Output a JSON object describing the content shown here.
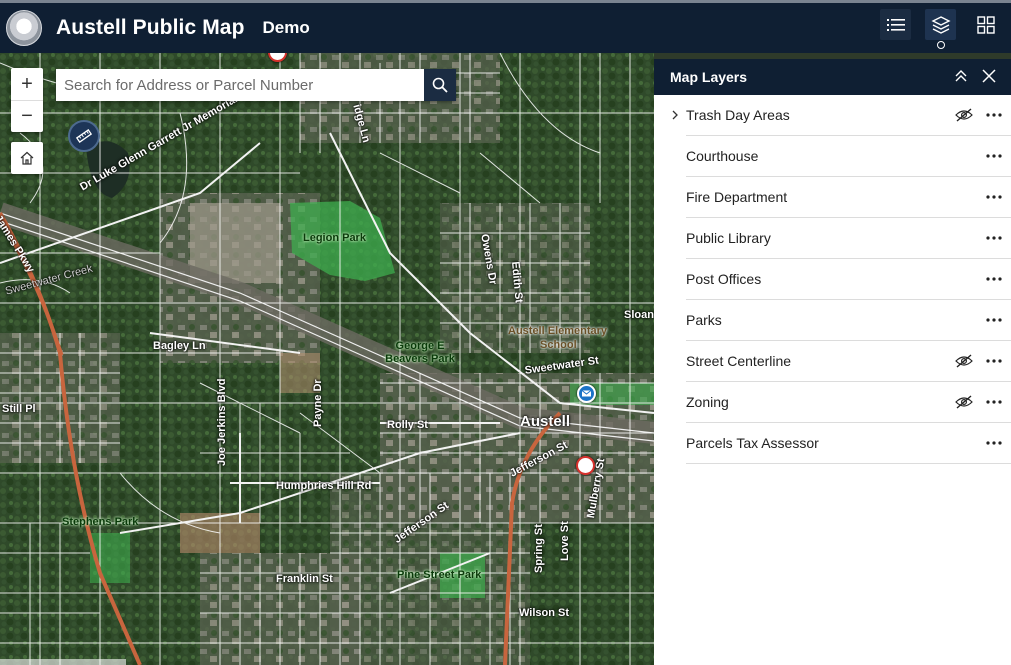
{
  "header": {
    "title": "Austell Public Map",
    "subtitle": "Demo"
  },
  "search": {
    "placeholder": "Search for Address or Parcel Number"
  },
  "zoom": {
    "in_label": "+",
    "out_label": "−"
  },
  "panel": {
    "title": "Map Layers",
    "layers": [
      {
        "label": "Trash Day Areas",
        "expandable": true,
        "hidden": true
      },
      {
        "label": "Courthouse",
        "expandable": false,
        "hidden": false
      },
      {
        "label": "Fire Department",
        "expandable": false,
        "hidden": false
      },
      {
        "label": "Public Library",
        "expandable": false,
        "hidden": false
      },
      {
        "label": "Post Offices",
        "expandable": false,
        "hidden": false
      },
      {
        "label": "Parks",
        "expandable": false,
        "hidden": false
      },
      {
        "label": "Street Centerline",
        "expandable": false,
        "hidden": true
      },
      {
        "label": "Zoning",
        "expandable": false,
        "hidden": true
      },
      {
        "label": "Parcels Tax Assessor",
        "expandable": false,
        "hidden": false
      }
    ]
  },
  "map": {
    "labels": {
      "legion_park": "Legion Park",
      "dr_luke": "Dr Luke Glenn Garrett Jr Memorial",
      "james_pkwy": "James Pkwy",
      "sweetwater_creek": "Sweetwater Creek",
      "bagley_ln": "Bagley Ln",
      "george_beavers_park": "George E Beavers Park",
      "still_pl": "Still Pl",
      "joe_jerkins_blvd": "Joe Jerkins Blvd",
      "payne_dr": "Payne Dr",
      "rolly_st": "Rolly St",
      "austell": "Austell",
      "humphries_hill_rd": "Humphries Hill Rd",
      "stephens_park": "Stephens Park",
      "jefferson_st": "Jefferson St",
      "jefferson_st_2": "Jefferson St",
      "franklin_st": "Franklin St",
      "pine_street_park": "Pine Street Park",
      "spring_st": "Spring St",
      "love_st": "Love St",
      "wilson_st": "Wilson St",
      "mulberry_st": "Mulberry St",
      "austell_elementary": "Austell Elementary",
      "school": "School",
      "sweetwater_st": "Sweetwater St",
      "owens_dr": "Owens Dr",
      "edith_st": "Edith St",
      "sloan": "Sloan",
      "ridge_ln": "idge Ln"
    },
    "colors": {
      "park": "#3fae4f",
      "road_major": "#c8653e",
      "parcel_line": "#ffffff",
      "post_office": "#1b73c7",
      "fire_marker": "#d6322d"
    }
  }
}
